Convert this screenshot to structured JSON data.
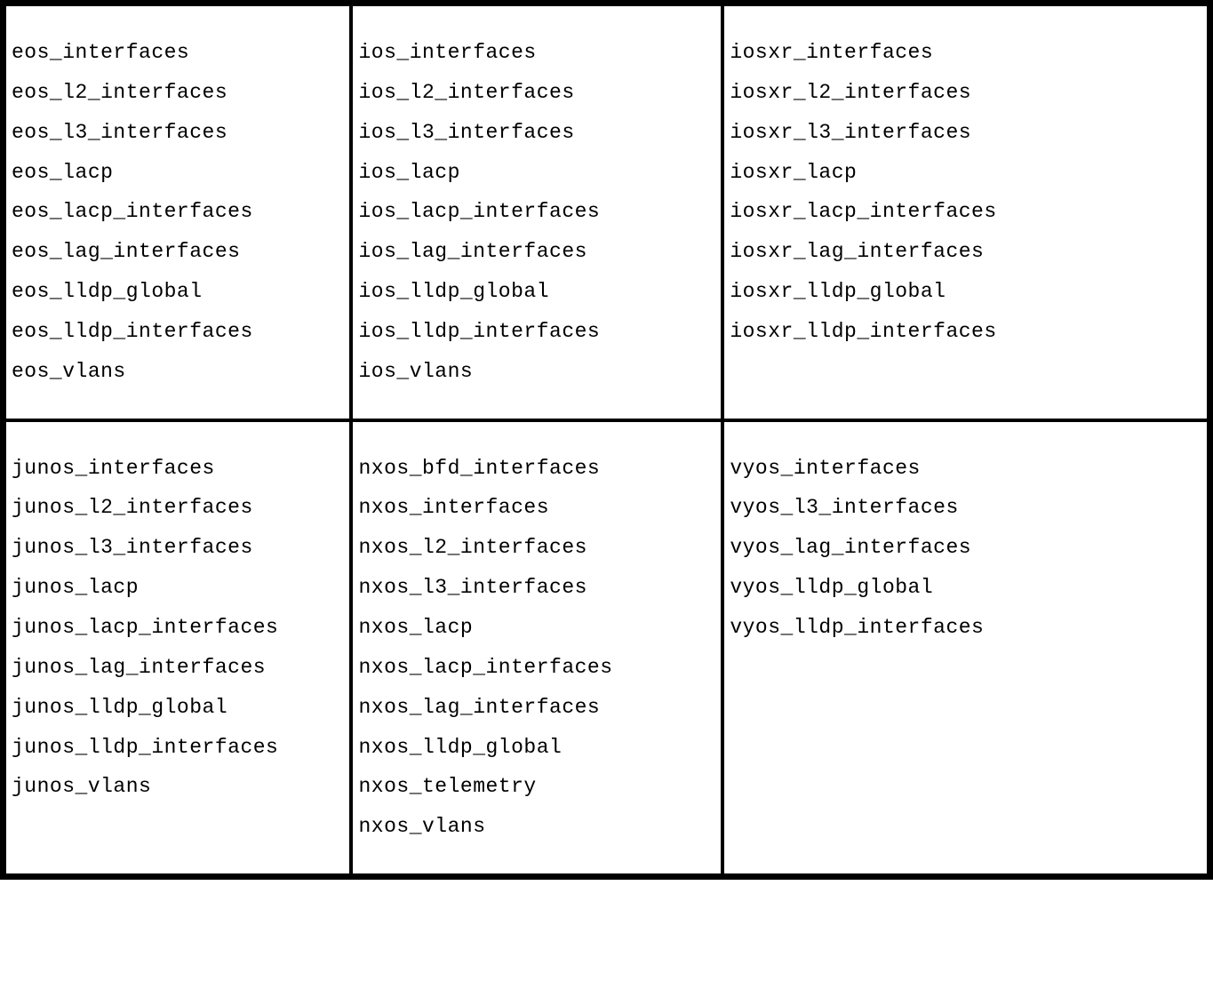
{
  "cells": [
    {
      "items": [
        "eos_interfaces",
        "eos_l2_interfaces",
        "eos_l3_interfaces",
        "eos_lacp",
        "eos_lacp_interfaces",
        "eos_lag_interfaces",
        "eos_lldp_global",
        "eos_lldp_interfaces",
        "eos_vlans"
      ]
    },
    {
      "items": [
        "ios_interfaces",
        "ios_l2_interfaces",
        "ios_l3_interfaces",
        "ios_lacp",
        "ios_lacp_interfaces",
        "ios_lag_interfaces",
        "ios_lldp_global",
        "ios_lldp_interfaces",
        "ios_vlans"
      ]
    },
    {
      "items": [
        "iosxr_interfaces",
        "iosxr_l2_interfaces",
        "iosxr_l3_interfaces",
        "iosxr_lacp",
        "iosxr_lacp_interfaces",
        "iosxr_lag_interfaces",
        "iosxr_lldp_global",
        "iosxr_lldp_interfaces"
      ]
    },
    {
      "items": [
        "junos_interfaces",
        "junos_l2_interfaces",
        "junos_l3_interfaces",
        "junos_lacp",
        "junos_lacp_interfaces",
        "junos_lag_interfaces",
        "junos_lldp_global",
        "junos_lldp_interfaces",
        "junos_vlans"
      ]
    },
    {
      "items": [
        "nxos_bfd_interfaces",
        "nxos_interfaces",
        "nxos_l2_interfaces",
        "nxos_l3_interfaces",
        "nxos_lacp",
        "nxos_lacp_interfaces",
        "nxos_lag_interfaces",
        "nxos_lldp_global",
        "nxos_telemetry",
        "nxos_vlans"
      ]
    },
    {
      "items": [
        "vyos_interfaces",
        "vyos_l3_interfaces",
        "vyos_lag_interfaces",
        "vyos_lldp_global",
        "vyos_lldp_interfaces"
      ]
    }
  ]
}
